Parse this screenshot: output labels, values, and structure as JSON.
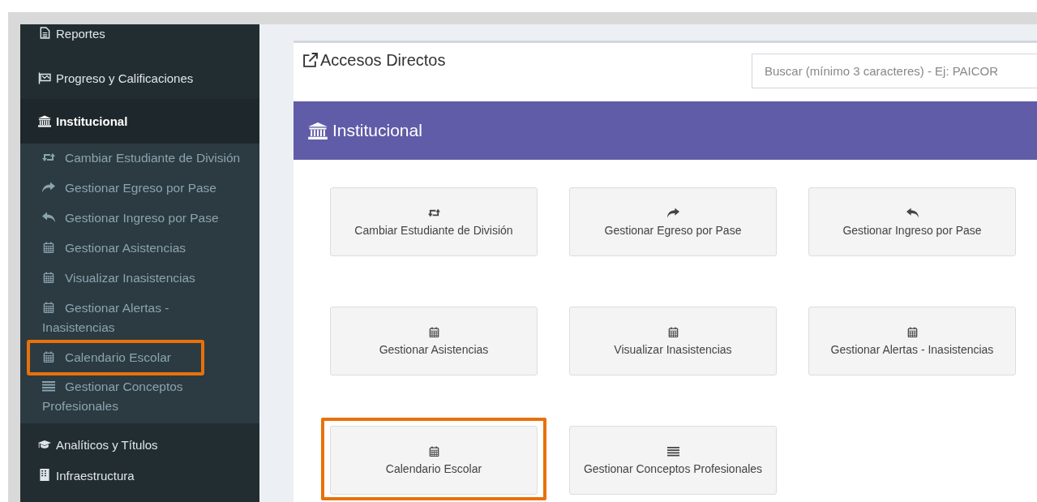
{
  "sidebar": {
    "items": [
      {
        "label": "Reportes",
        "kind": "file",
        "selected": false
      },
      {
        "label": "Progreso y Calificaciones",
        "kind": "flag",
        "selected": false
      },
      {
        "label": "Institucional",
        "kind": "bank",
        "selected": true,
        "expanded": true,
        "children": [
          {
            "label": "Cambiar Estudiante de División",
            "kind": "retweet",
            "highlighted": false
          },
          {
            "label": "Gestionar Egreso por Pase",
            "kind": "share",
            "highlighted": false
          },
          {
            "label": "Gestionar Ingreso por Pase",
            "kind": "reply",
            "highlighted": false
          },
          {
            "label": "Gestionar Asistencias",
            "kind": "calendar",
            "highlighted": false
          },
          {
            "label": "Visualizar Inasistencias",
            "kind": "calendar",
            "highlighted": false
          },
          {
            "label": "Gestionar Alertas - Inasistencias",
            "kind": "calendar",
            "highlighted": false
          },
          {
            "label": "Calendario Escolar",
            "kind": "calendar",
            "highlighted": true
          },
          {
            "label": "Gestionar Conceptos Profesionales",
            "kind": "list",
            "highlighted": false
          }
        ]
      },
      {
        "label": "Analíticos y Títulos",
        "kind": "cap",
        "selected": false
      },
      {
        "label": "Infraestructura",
        "kind": "building",
        "selected": false
      }
    ]
  },
  "panel": {
    "title": "Accesos Directos",
    "search": {
      "placeholder": "Buscar (mínimo 3 caracteres) - Ej: PAICOR"
    },
    "section": {
      "title": "Institucional",
      "kind": "bank"
    },
    "tiles": [
      {
        "label": "Cambiar Estudiante de División",
        "kind": "retweet",
        "highlighted": false
      },
      {
        "label": "Gestionar Egreso por Pase",
        "kind": "share",
        "highlighted": false
      },
      {
        "label": "Gestionar Ingreso por Pase",
        "kind": "reply",
        "highlighted": false
      },
      {
        "label": "Gestionar Asistencias",
        "kind": "calendar",
        "highlighted": false
      },
      {
        "label": "Visualizar Inasistencias",
        "kind": "calendar",
        "highlighted": false
      },
      {
        "label": "Gestionar Alertas - Inasistencias",
        "kind": "calendar",
        "highlighted": false
      },
      {
        "label": "Calendario Escolar",
        "kind": "calendar",
        "highlighted": true
      },
      {
        "label": "Gestionar Conceptos Profesionales",
        "kind": "list",
        "highlighted": false
      }
    ]
  }
}
